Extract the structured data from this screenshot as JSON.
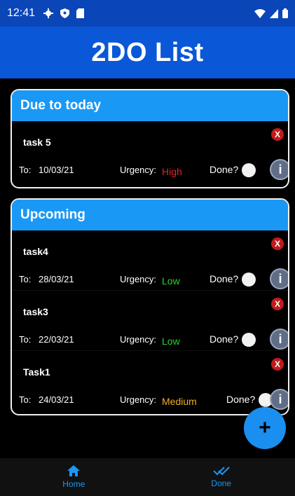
{
  "status_bar": {
    "time": "12:41",
    "left_icons": [
      "gear-icon",
      "shield-icon",
      "sd-card-icon"
    ],
    "right_icons": [
      "wifi-icon",
      "signal-icon",
      "battery-icon"
    ]
  },
  "header": {
    "title": "2DO List"
  },
  "sections": {
    "today": {
      "title": "Due to today",
      "tasks": [
        {
          "name": "task 5",
          "to_label": "To:",
          "date": "10/03/21",
          "urgency_label": "Urgency:",
          "urgency": "High",
          "done_label": "Done?"
        }
      ]
    },
    "upcoming": {
      "title": "Upcoming",
      "tasks": [
        {
          "name": "task4",
          "to_label": "To:",
          "date": "28/03/21",
          "urgency_label": "Urgency:",
          "urgency": "Low",
          "done_label": "Done?"
        },
        {
          "name": "task3",
          "to_label": "To:",
          "date": "22/03/21",
          "urgency_label": "Urgency:",
          "urgency": "Low",
          "done_label": "Done?"
        },
        {
          "name": "Task1",
          "to_label": "To:",
          "date": "24/03/21",
          "urgency_label": "Urgency:",
          "urgency": "Medium",
          "done_label": "Done?"
        }
      ]
    }
  },
  "buttons": {
    "delete": "X",
    "info": "i",
    "add": "+"
  },
  "nav": {
    "home_label": "Home",
    "done_label": "Done"
  },
  "colors": {
    "accent": "#1a98f5",
    "header": "#0a57d8",
    "high": "#e0242a",
    "low": "#2bd12b",
    "medium": "#f0b020"
  }
}
